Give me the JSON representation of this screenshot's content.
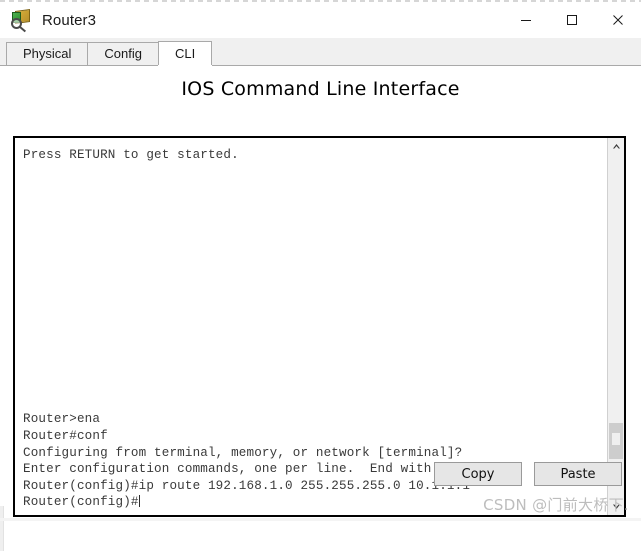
{
  "window": {
    "title": "Router3",
    "icon": "packet-tracer-router-icon",
    "controls": {
      "minimize": "—",
      "maximize": "□",
      "close": "×"
    }
  },
  "tabs": [
    {
      "label": "Physical",
      "active": false
    },
    {
      "label": "Config",
      "active": false
    },
    {
      "label": "CLI",
      "active": true
    }
  ],
  "main": {
    "heading": "IOS Command Line Interface",
    "terminal": {
      "top_lines": [
        "Press RETURN to get started."
      ],
      "bottom_lines": [
        "Router>ena",
        "Router#conf",
        "Configuring from terminal, memory, or network [terminal]?",
        "Enter configuration commands, one per line.  End with CNTL/Z.",
        "Router(config)#ip route 192.168.1.0 255.255.255.0 10.1.1.1",
        "Router(config)#"
      ],
      "text_color": "#3a3a3a",
      "background": "#ffffff"
    },
    "scrollbar": {
      "up_arrow": "scroll-up-arrow",
      "down_arrow": "scroll-down-arrow",
      "thumb_top_pct": 78,
      "thumb_height_pct": 10
    }
  },
  "footer": {
    "copy_label": "Copy",
    "paste_label": "Paste"
  },
  "watermark": {
    "text": "CSDN @门前大桥下.",
    "color": "#bdbdbd"
  }
}
